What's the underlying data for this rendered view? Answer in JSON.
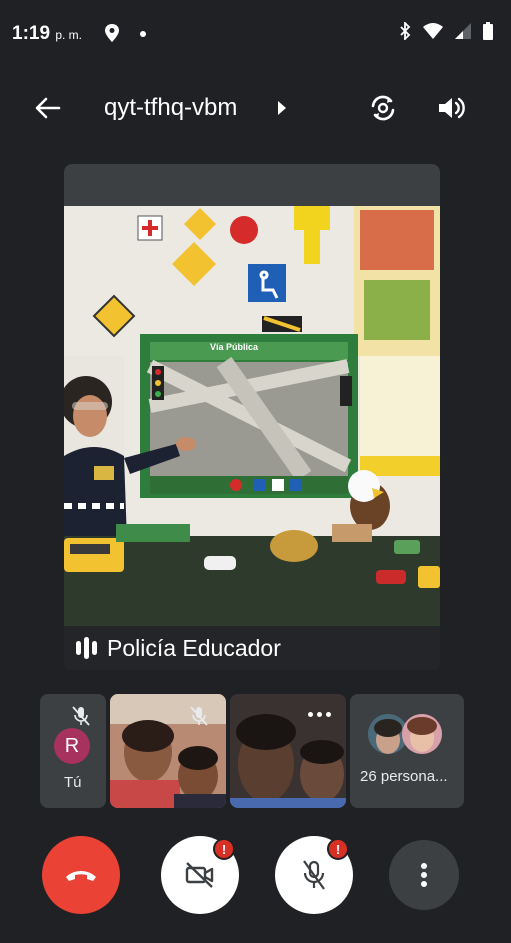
{
  "status": {
    "time": "1:19",
    "ampm": "p. m."
  },
  "header": {
    "meeting_code": "qyt-tfhq-vbm"
  },
  "main_tile": {
    "presenter_name": "Policía Educador",
    "board_title": "Vía Pública"
  },
  "participants": {
    "self_initial": "R",
    "self_label": "Tú",
    "others_label": "26 persona..."
  },
  "controls": {
    "camera_badge": "!",
    "mic_badge": "!"
  },
  "colors": {
    "background": "#202124",
    "end_call": "#ea4335",
    "badge": "#d93025"
  }
}
